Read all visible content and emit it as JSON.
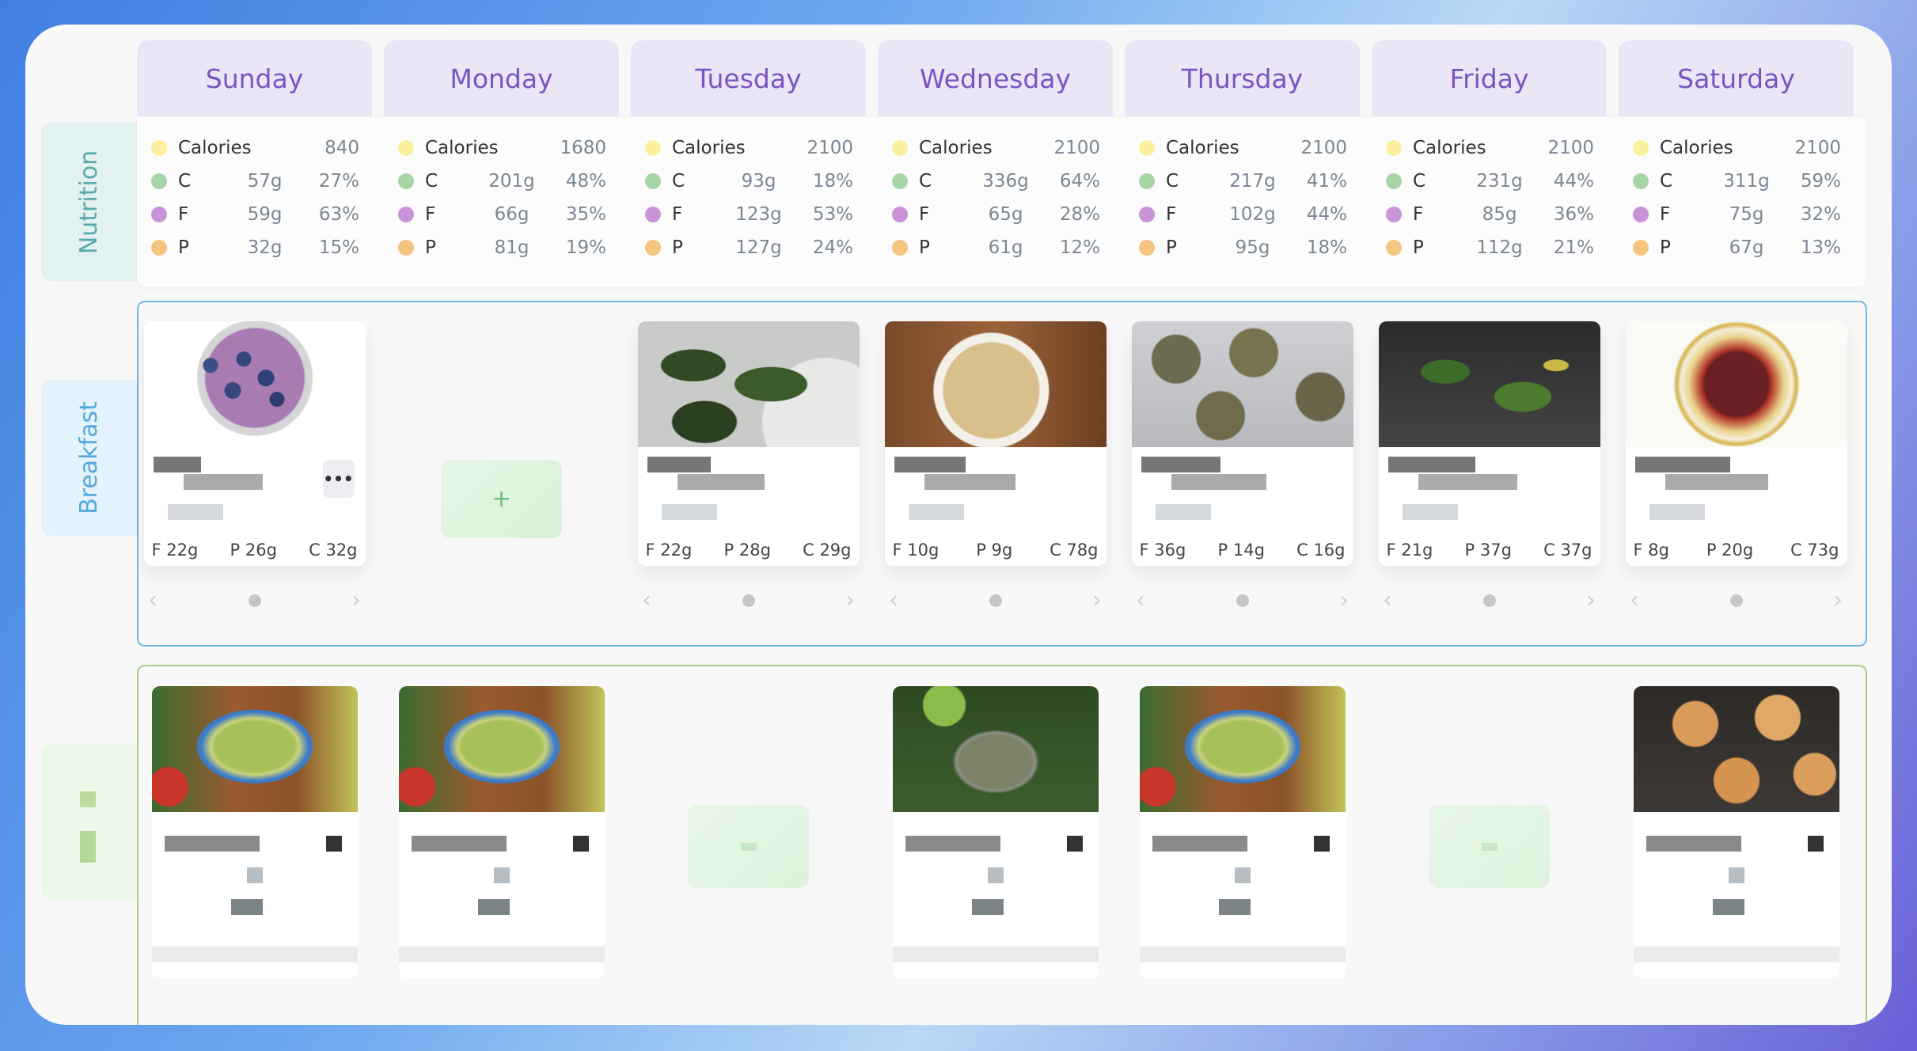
{
  "days": [
    {
      "name": "Sunday",
      "nutrition": {
        "calories": "840",
        "c": [
          "57g",
          "27%"
        ],
        "f": [
          "59g",
          "63%"
        ],
        "p": [
          "32g",
          "15%"
        ]
      }
    },
    {
      "name": "Monday",
      "nutrition": {
        "calories": "1680",
        "c": [
          "201g",
          "48%"
        ],
        "f": [
          "66g",
          "35%"
        ],
        "p": [
          "81g",
          "19%"
        ]
      }
    },
    {
      "name": "Tuesday",
      "nutrition": {
        "calories": "2100",
        "c": [
          "93g",
          "18%"
        ],
        "f": [
          "123g",
          "53%"
        ],
        "p": [
          "127g",
          "24%"
        ]
      }
    },
    {
      "name": "Wednesday",
      "nutrition": {
        "calories": "2100",
        "c": [
          "336g",
          "64%"
        ],
        "f": [
          "65g",
          "28%"
        ],
        "p": [
          "61g",
          "12%"
        ]
      }
    },
    {
      "name": "Thursday",
      "nutrition": {
        "calories": "2100",
        "c": [
          "217g",
          "41%"
        ],
        "f": [
          "102g",
          "44%"
        ],
        "p": [
          "95g",
          "18%"
        ]
      }
    },
    {
      "name": "Friday",
      "nutrition": {
        "calories": "2100",
        "c": [
          "231g",
          "44%"
        ],
        "f": [
          "85g",
          "36%"
        ],
        "p": [
          "112g",
          "21%"
        ]
      }
    },
    {
      "name": "Saturday",
      "nutrition": {
        "calories": "2100",
        "c": [
          "311g",
          "59%"
        ],
        "f": [
          "75g",
          "32%"
        ],
        "p": [
          "67g",
          "13%"
        ]
      }
    }
  ],
  "labels": {
    "calories": "Calories",
    "c": "C",
    "f": "F",
    "p": "P"
  },
  "rows": {
    "nutrition": "Nutrition",
    "breakfast": "Breakfast"
  },
  "breakfast": [
    {
      "image": "blueberry-smoothie",
      "macros": [
        "F 22g",
        "P 26g",
        "C 32g"
      ]
    },
    null,
    {
      "image": "spinach-patties",
      "macros": [
        "F 22g",
        "P 28g",
        "C 29g"
      ]
    },
    {
      "image": "oatmeal",
      "macros": [
        "F 10g",
        "P 9g",
        "C 78g"
      ]
    },
    {
      "image": "seed-cookies",
      "macros": [
        "F 36g",
        "P 14g",
        "C 16g"
      ]
    },
    {
      "image": "kale-tray",
      "macros": [
        "F 21g",
        "P 37g",
        "C 37g"
      ]
    },
    {
      "image": "bean-salad",
      "macros": [
        "F 8g",
        "P 20g",
        "C 73g"
      ]
    }
  ],
  "row2": [
    "guacamole-salad",
    "guacamole-salad",
    null,
    "green-smoothie",
    "guacamole-salad",
    null,
    "muffins"
  ],
  "icons": {
    "add": "+",
    "more": "•••",
    "prev": "‹",
    "next": "›"
  },
  "colors": {
    "calories": "#fbf0a0",
    "c": "#a8d5a6",
    "f": "#c993d8",
    "p": "#f5c47e",
    "day_header": "#7a55c2",
    "breakfast_border": "#72b8e2",
    "row2_border": "#a9cf7f"
  }
}
